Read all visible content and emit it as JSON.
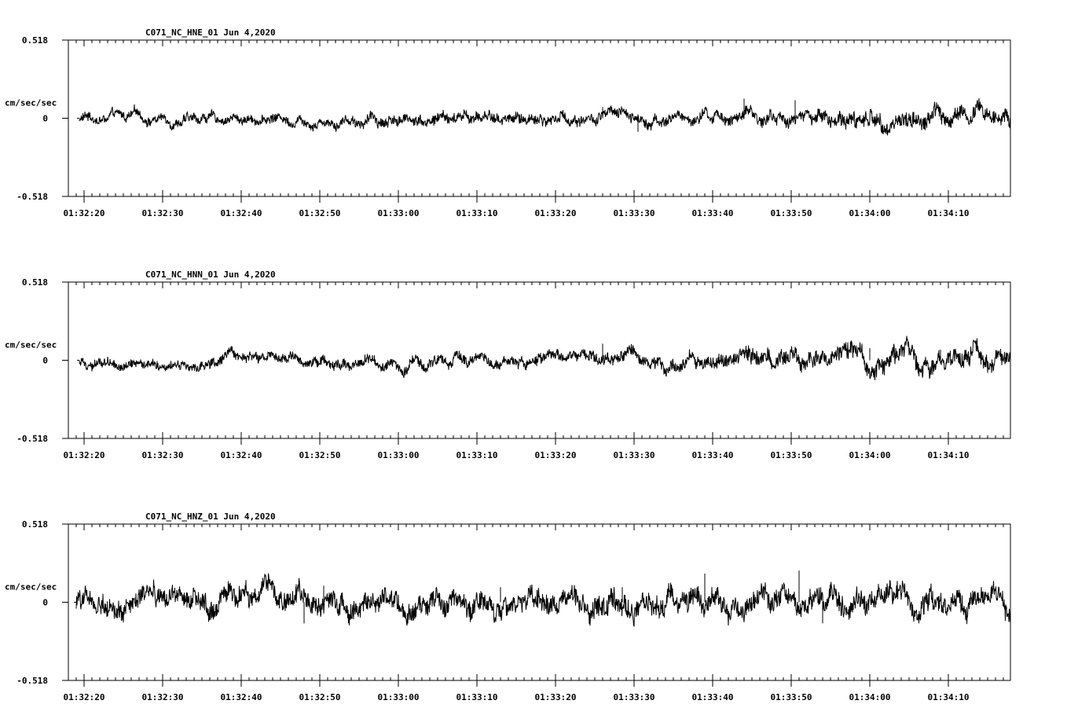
{
  "chart_data": [
    {
      "type": "line",
      "title": "C071_NC_HNE_01   Jun 4,2020",
      "ylabel": "cm/sec/sec",
      "ylim": [
        -0.518,
        0.518
      ],
      "y_ticks": [
        "0.518",
        "0",
        "-0.518"
      ],
      "x_ticks": [
        "01:32:20",
        "01:32:30",
        "01:32:40",
        "01:32:50",
        "01:33:00",
        "01:33:10",
        "01:33:20",
        "01:33:30",
        "01:33:40",
        "01:33:50",
        "01:34:00",
        "01:34:10"
      ],
      "xlim_seconds_from_first_tick": [
        -2.0,
        118.0
      ],
      "trace_start_seconds_from_first_tick": -0.6,
      "series": [
        {
          "noise_amplitude_profile": [
            [
              -0.6,
              0.025
            ],
            [
              20,
              0.025
            ],
            [
              40,
              0.03
            ],
            [
              60,
              0.03
            ],
            [
              80,
              0.03
            ],
            [
              90,
              0.035
            ],
            [
              100,
              0.045
            ],
            [
              110,
              0.05
            ],
            [
              118,
              0.05
            ]
          ],
          "spikes": [
            [
              66,
              0.075
            ],
            [
              70.5,
              -0.09
            ],
            [
              84,
              0.13
            ],
            [
              90.5,
              0.12
            ]
          ]
        }
      ]
    },
    {
      "type": "line",
      "title": "C071_NC_HNN_01   Jun 4,2020",
      "ylabel": "cm/sec/sec",
      "ylim": [
        -0.518,
        0.518
      ],
      "y_ticks": [
        "0.518",
        "0",
        "-0.518"
      ],
      "x_ticks": [
        "01:32:20",
        "01:32:30",
        "01:32:40",
        "01:32:50",
        "01:33:00",
        "01:33:10",
        "01:33:20",
        "01:33:30",
        "01:33:40",
        "01:33:50",
        "01:34:00",
        "01:34:10"
      ],
      "xlim_seconds_from_first_tick": [
        -2.0,
        118.0
      ],
      "trace_start_seconds_from_first_tick": -0.6,
      "series": [
        {
          "noise_amplitude_profile": [
            [
              -0.6,
              0.025
            ],
            [
              30,
              0.028
            ],
            [
              60,
              0.03
            ],
            [
              75,
              0.035
            ],
            [
              85,
              0.045
            ],
            [
              100,
              0.05
            ],
            [
              118,
              0.05
            ]
          ],
          "spikes": [
            [
              66,
              0.11
            ],
            [
              100,
              0.08
            ],
            [
              109,
              0.07
            ]
          ]
        }
      ]
    },
    {
      "type": "line",
      "title": "C071_NC_HNZ_01   Jun 4,2020",
      "ylabel": "cm/sec/sec",
      "ylim": [
        -0.518,
        0.518
      ],
      "y_ticks": [
        "0.518",
        "0",
        "-0.518"
      ],
      "x_ticks": [
        "01:32:20",
        "01:32:30",
        "01:32:40",
        "01:32:50",
        "01:33:00",
        "01:33:10",
        "01:33:20",
        "01:33:30",
        "01:33:40",
        "01:33:50",
        "01:34:00",
        "01:34:10"
      ],
      "xlim_seconds_from_first_tick": [
        -2.0,
        118.0
      ],
      "trace_start_seconds_from_first_tick": -1.0,
      "series": [
        {
          "noise_amplitude_profile": [
            [
              -1.0,
              0.05
            ],
            [
              20,
              0.055
            ],
            [
              40,
              0.06
            ],
            [
              60,
              0.06
            ],
            [
              80,
              0.06
            ],
            [
              100,
              0.06
            ],
            [
              118,
              0.06
            ]
          ],
          "spikes": [
            [
              27.0,
              0.12
            ],
            [
              28.0,
              -0.14
            ],
            [
              30.5,
              0.11
            ],
            [
              53.0,
              0.1
            ],
            [
              62.5,
              0.09
            ],
            [
              68.5,
              0.1
            ],
            [
              79.0,
              0.19
            ],
            [
              91.0,
              0.21
            ],
            [
              94.0,
              -0.14
            ]
          ]
        }
      ]
    }
  ]
}
